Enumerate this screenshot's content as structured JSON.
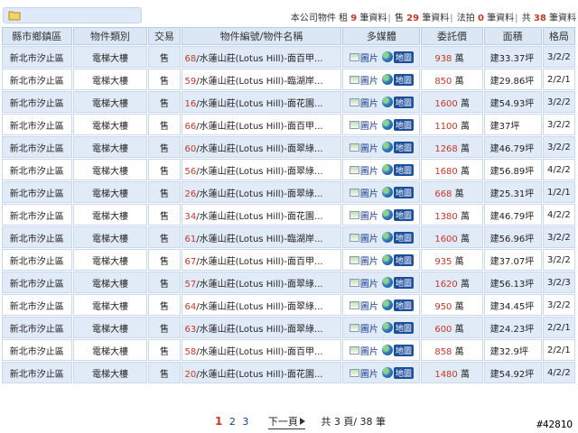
{
  "summary": {
    "prefix": "本公司物件",
    "rent_label": "租",
    "rent_count": "9",
    "sell_label": "售",
    "sell_count": "29",
    "auction_label": "法拍",
    "auction_count": "0",
    "total_label": "共",
    "total_count": "38",
    "unit": "筆資料"
  },
  "columns": [
    "縣市鄉鎮區",
    "物件類別",
    "交易",
    "物件編號/物件名稱",
    "多媒體",
    "委託價",
    "面積",
    "格局"
  ],
  "media": {
    "picture_label": "圖片",
    "map_label": "地圖"
  },
  "price_unit": "萬",
  "rows": [
    {
      "region": "新北市汐止區",
      "category": "電梯大樓",
      "trade": "售",
      "id": "68",
      "name": "/水蓮山莊(Lotus Hill)-面百甲...",
      "price": "938",
      "area": "建33.37坪",
      "layout": "3/2/2"
    },
    {
      "region": "新北市汐止區",
      "category": "電梯大樓",
      "trade": "售",
      "id": "59",
      "name": "/水蓮山莊(Lotus Hill)-臨湖岸...",
      "price": "850",
      "area": "建29.86坪",
      "layout": "2/2/1"
    },
    {
      "region": "新北市汐止區",
      "category": "電梯大樓",
      "trade": "售",
      "id": "16",
      "name": "/水蓮山莊(Lotus Hill)-面花園...",
      "price": "1600",
      "area": "建54.93坪",
      "layout": "3/2/2"
    },
    {
      "region": "新北市汐止區",
      "category": "電梯大樓",
      "trade": "售",
      "id": "66",
      "name": "/水蓮山莊(Lotus Hill)-面百甲...",
      "price": "1100",
      "area": "建37坪",
      "layout": "3/2/2"
    },
    {
      "region": "新北市汐止區",
      "category": "電梯大樓",
      "trade": "售",
      "id": "60",
      "name": "/水蓮山莊(Lotus Hill)-面翠綠...",
      "price": "1268",
      "area": "建46.79坪",
      "layout": "3/2/2"
    },
    {
      "region": "新北市汐止區",
      "category": "電梯大樓",
      "trade": "售",
      "id": "56",
      "name": "/水蓮山莊(Lotus Hill)-面翠綠...",
      "price": "1680",
      "area": "建56.89坪",
      "layout": "4/2/2"
    },
    {
      "region": "新北市汐止區",
      "category": "電梯大樓",
      "trade": "售",
      "id": "26",
      "name": "/水蓮山莊(Lotus Hill)-面翠綠...",
      "price": "668",
      "area": "建25.31坪",
      "layout": "1/2/1"
    },
    {
      "region": "新北市汐止區",
      "category": "電梯大樓",
      "trade": "售",
      "id": "34",
      "name": "/水蓮山莊(Lotus Hill)-面花園...",
      "price": "1380",
      "area": "建46.79坪",
      "layout": "4/2/2"
    },
    {
      "region": "新北市汐止區",
      "category": "電梯大樓",
      "trade": "售",
      "id": "61",
      "name": "/水蓮山莊(Lotus Hill)-臨湖岸...",
      "price": "1600",
      "area": "建56.96坪",
      "layout": "3/2/2"
    },
    {
      "region": "新北市汐止區",
      "category": "電梯大樓",
      "trade": "售",
      "id": "67",
      "name": "/水蓮山莊(Lotus Hill)-面百甲...",
      "price": "935",
      "area": "建37.07坪",
      "layout": "3/2/2"
    },
    {
      "region": "新北市汐止區",
      "category": "電梯大樓",
      "trade": "售",
      "id": "57",
      "name": "/水蓮山莊(Lotus Hill)-面翠綠...",
      "price": "1620",
      "area": "建56.13坪",
      "layout": "3/2/3"
    },
    {
      "region": "新北市汐止區",
      "category": "電梯大樓",
      "trade": "售",
      "id": "64",
      "name": "/水蓮山莊(Lotus Hill)-面翠綠...",
      "price": "950",
      "area": "建34.45坪",
      "layout": "3/2/2"
    },
    {
      "region": "新北市汐止區",
      "category": "電梯大樓",
      "trade": "售",
      "id": "63",
      "name": "/水蓮山莊(Lotus Hill)-面翠綠...",
      "price": "600",
      "area": "建24.23坪",
      "layout": "2/2/1"
    },
    {
      "region": "新北市汐止區",
      "category": "電梯大樓",
      "trade": "售",
      "id": "58",
      "name": "/水蓮山莊(Lotus Hill)-面百甲...",
      "price": "858",
      "area": "建32.9坪",
      "layout": "2/2/1"
    },
    {
      "region": "新北市汐止區",
      "category": "電梯大樓",
      "trade": "售",
      "id": "20",
      "name": "/水蓮山莊(Lotus Hill)-面花園...",
      "price": "1480",
      "area": "建54.92坪",
      "layout": "4/2/2"
    }
  ],
  "pager": {
    "current": "1",
    "pages": [
      "2",
      "3"
    ],
    "next_label": "下一頁",
    "total_text": "共 3 頁/ 38 筆"
  },
  "watermark": "#4281O"
}
